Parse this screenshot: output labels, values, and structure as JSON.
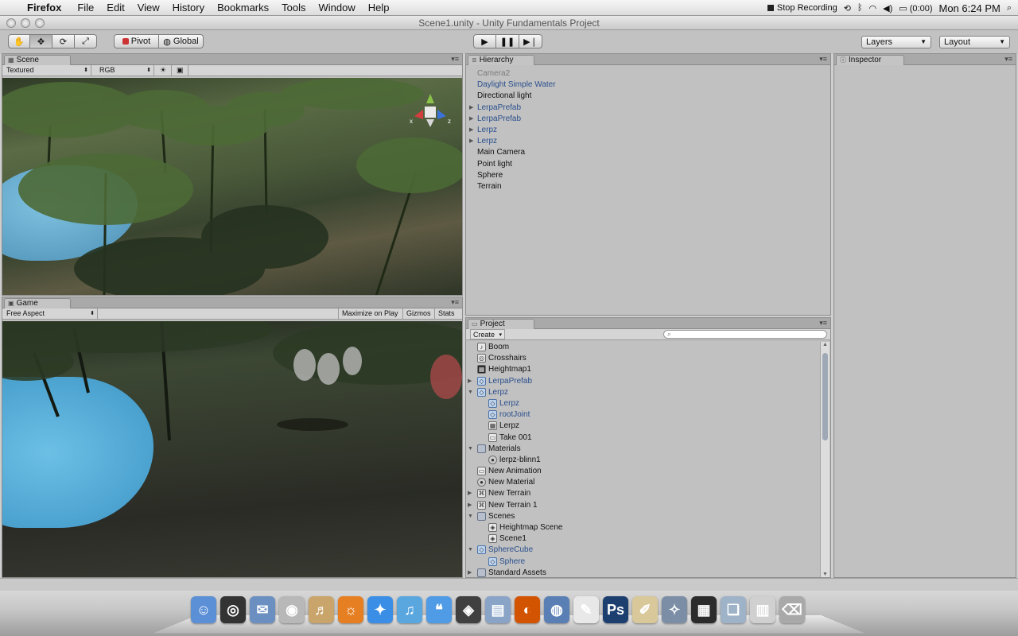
{
  "menubar": {
    "app_name": "Firefox",
    "items": [
      "File",
      "Edit",
      "View",
      "History",
      "Bookmarks",
      "Tools",
      "Window",
      "Help"
    ],
    "stop_recording": "Stop Recording",
    "battery": "(0:00)",
    "clock": "Mon 6:24 PM"
  },
  "window": {
    "title": "Scene1.unity - Unity Fundamentals Project"
  },
  "toolbar": {
    "pivot_label": "Pivot",
    "global_label": "Global",
    "layers_label": "Layers",
    "layout_label": "Layout"
  },
  "scene": {
    "tab_label": "Scene",
    "render_mode": "Textured",
    "color_mode": "RGB",
    "gizmo_axes": [
      "x",
      "z"
    ]
  },
  "game": {
    "tab_label": "Game",
    "aspect": "Free Aspect",
    "maximize_label": "Maximize on Play",
    "gizmos_label": "Gizmos",
    "stats_label": "Stats"
  },
  "hierarchy": {
    "tab_label": "Hierarchy",
    "items": [
      {
        "label": "Camera2",
        "style": "dim",
        "expandable": false
      },
      {
        "label": "Daylight Simple Water",
        "style": "blue",
        "expandable": false
      },
      {
        "label": "Directional light",
        "style": "normal",
        "expandable": false
      },
      {
        "label": "LerpaPrefab",
        "style": "blue",
        "expandable": true
      },
      {
        "label": "LerpaPrefab",
        "style": "blue",
        "expandable": true
      },
      {
        "label": "Lerpz",
        "style": "blue",
        "expandable": true
      },
      {
        "label": "Lerpz",
        "style": "blue",
        "expandable": true
      },
      {
        "label": "Main Camera",
        "style": "normal",
        "expandable": false
      },
      {
        "label": "Point light",
        "style": "normal",
        "expandable": false
      },
      {
        "label": "Sphere",
        "style": "normal",
        "expandable": false
      },
      {
        "label": "Terrain",
        "style": "normal",
        "expandable": false
      }
    ]
  },
  "project": {
    "tab_label": "Project",
    "create_label": "Create",
    "items": [
      {
        "label": "Boom",
        "indent": 0,
        "icon": "sound",
        "tri": ""
      },
      {
        "label": "Crosshairs",
        "indent": 0,
        "icon": "target",
        "tri": ""
      },
      {
        "label": "Heightmap1",
        "indent": 0,
        "icon": "dark",
        "tri": ""
      },
      {
        "label": "LerpaPrefab",
        "indent": 0,
        "icon": "prefab",
        "tri": "▶"
      },
      {
        "label": "Lerpz",
        "indent": 0,
        "icon": "prefab",
        "tri": "▼"
      },
      {
        "label": "Lerpz",
        "indent": 1,
        "icon": "prefab",
        "tri": ""
      },
      {
        "label": "rootJoint",
        "indent": 1,
        "icon": "prefab",
        "tri": ""
      },
      {
        "label": "Lerpz",
        "indent": 1,
        "icon": "grid",
        "tri": ""
      },
      {
        "label": "Take 001",
        "indent": 1,
        "icon": "anim",
        "tri": ""
      },
      {
        "label": "Materials",
        "indent": 0,
        "icon": "folder",
        "tri": "▼"
      },
      {
        "label": "lerpz-blinn1",
        "indent": 1,
        "icon": "round",
        "tri": ""
      },
      {
        "label": "New Animation",
        "indent": 0,
        "icon": "anim",
        "tri": ""
      },
      {
        "label": "New Material",
        "indent": 0,
        "icon": "round",
        "tri": ""
      },
      {
        "label": "New Terrain",
        "indent": 0,
        "icon": "terrain",
        "tri": "▶"
      },
      {
        "label": "New Terrain 1",
        "indent": 0,
        "icon": "terrain",
        "tri": "▶"
      },
      {
        "label": "Scenes",
        "indent": 0,
        "icon": "folder",
        "tri": "▼"
      },
      {
        "label": "Heightmap Scene",
        "indent": 1,
        "icon": "unity",
        "tri": ""
      },
      {
        "label": "Scene1",
        "indent": 1,
        "icon": "unity",
        "tri": ""
      },
      {
        "label": "SphereCube",
        "indent": 0,
        "icon": "prefab",
        "tri": "▼"
      },
      {
        "label": "Sphere",
        "indent": 1,
        "icon": "prefab",
        "tri": ""
      },
      {
        "label": "Standard Assets",
        "indent": 0,
        "icon": "folder",
        "tri": "▶"
      }
    ]
  },
  "inspector": {
    "tab_label": "Inspector"
  },
  "dock": {
    "apps": [
      {
        "name": "finder-icon",
        "color": "#5b8fd6",
        "glyph": "☺"
      },
      {
        "name": "dashboard-icon",
        "color": "#333333",
        "glyph": "◎"
      },
      {
        "name": "mail-icon",
        "color": "#6a8fc0",
        "glyph": "✉"
      },
      {
        "name": "dvd-icon",
        "color": "#b8b8b8",
        "glyph": "◉"
      },
      {
        "name": "garageband-icon",
        "color": "#c9a46b",
        "glyph": "♬"
      },
      {
        "name": "firefox-icon",
        "color": "#e67e22",
        "glyph": "☼"
      },
      {
        "name": "safari-icon",
        "color": "#3a8ee6",
        "glyph": "✦"
      },
      {
        "name": "itunes-icon",
        "color": "#5aa7e0",
        "glyph": "♫"
      },
      {
        "name": "ichat-icon",
        "color": "#4f9be6",
        "glyph": "❝"
      },
      {
        "name": "unity-icon",
        "color": "#404040",
        "glyph": "◈"
      },
      {
        "name": "preview-icon",
        "color": "#8aa4c8",
        "glyph": "▤"
      },
      {
        "name": "audio-icon",
        "color": "#d35400",
        "glyph": "◐"
      },
      {
        "name": "network-icon",
        "color": "#5a7fb5",
        "glyph": "◍"
      },
      {
        "name": "textedit-icon",
        "color": "#e8e8e8",
        "glyph": "✎"
      },
      {
        "name": "photoshop-icon",
        "color": "#1c3f70",
        "glyph": "Ps"
      },
      {
        "name": "script-icon",
        "color": "#d8c89a",
        "glyph": "✐"
      },
      {
        "name": "utility-icon",
        "color": "#7b8ea6",
        "glyph": "✧"
      },
      {
        "name": "clapper-icon",
        "color": "#2b2b2b",
        "glyph": "▦"
      },
      {
        "name": "preview2-icon",
        "color": "#9fb3c8",
        "glyph": "❏"
      },
      {
        "name": "documents-icon",
        "color": "#d0d0d0",
        "glyph": "▥"
      },
      {
        "name": "trash-icon",
        "color": "#a9a9a9",
        "glyph": "⌫"
      }
    ]
  }
}
